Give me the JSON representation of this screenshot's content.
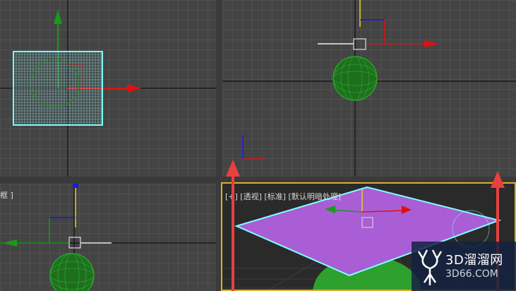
{
  "viewports": {
    "top_left": {
      "label": ""
    },
    "top_right": {
      "label": ""
    },
    "bottom_left": {
      "label": "框 ]"
    },
    "bottom_right": {
      "label": "[+] [透视] [标准] [默认明暗处理]"
    }
  },
  "watermark": {
    "title": "3D溜溜网",
    "url": "3D66.COM"
  },
  "colors": {
    "grid": "#5a5a5a",
    "axis_red": "#e01010",
    "axis_green": "#1a9a1a",
    "axis_blue": "#1a1ae0",
    "sphere": "#1e7a1e",
    "selection": "#7fffff",
    "plane_purple": "#a95ed6"
  }
}
